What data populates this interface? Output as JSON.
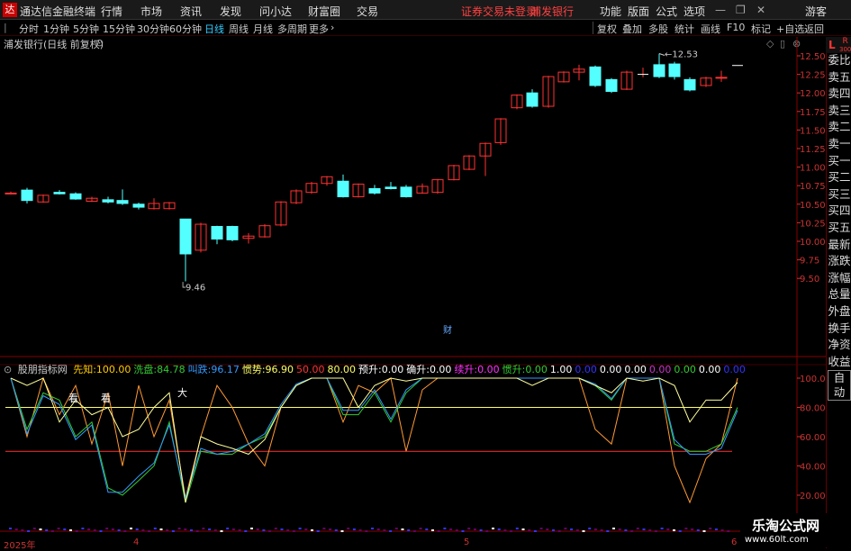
{
  "app": {
    "title": "通达信金融终端",
    "menu": [
      "行情",
      "市场",
      "资讯",
      "发现",
      "问小达",
      "财富圈",
      "交易"
    ],
    "warning": "证券交易未登录",
    "stock_name": "浦发银行",
    "right_menu": [
      "功能",
      "版面",
      "公式",
      "选项"
    ],
    "guest": "游客"
  },
  "toolbar": {
    "periods": [
      "分时",
      "1分钟",
      "5分钟",
      "15分钟",
      "30分钟",
      "60分钟",
      "日线",
      "周线",
      "月线",
      "多周期",
      "更多"
    ],
    "active_period": "日线",
    "more_arrow": "›",
    "right_buttons": [
      "复权",
      "叠加",
      "多股",
      "统计",
      "画线",
      "F10",
      "标记",
      "+自选",
      "返回"
    ]
  },
  "chart": {
    "subtitle": "浦发银行(日线 前复权)",
    "price_axis": [
      "12.50",
      "12.25",
      "12.00",
      "11.75",
      "11.50",
      "11.25",
      "11.00",
      "10.75",
      "10.50",
      "10.25",
      "10.00",
      "9.75",
      "9.50"
    ],
    "high_label": "12.53",
    "low_label": "9.46",
    "finance_marker": "财"
  },
  "indicator": {
    "name": "股朋指标网",
    "values": [
      {
        "label": "先知:",
        "value": "100.00",
        "color": "#ffcc00"
      },
      {
        "label": "洗盘:",
        "value": "84.78",
        "color": "#33cc33"
      },
      {
        "label": "叫跌:",
        "value": "96.17",
        "color": "#3399ff"
      },
      {
        "label": "惯势:",
        "value": "96.90",
        "color": "#ffff66"
      },
      {
        "label": "",
        "value": "50.00",
        "color": "#ff3333"
      },
      {
        "label": "",
        "value": "80.00",
        "color": "#ffff66"
      },
      {
        "label": "预升:",
        "value": "0.00",
        "color": "#ffffff"
      },
      {
        "label": "确升:",
        "value": "0.00",
        "color": "#ffffff"
      },
      {
        "label": "续升:",
        "value": "0.00",
        "color": "#ff33ff"
      },
      {
        "label": "惯升:",
        "value": "0.00",
        "color": "#33cc33"
      },
      {
        "label": "",
        "value": "1.00",
        "color": "#ffffff"
      },
      {
        "label": "",
        "value": "0.00",
        "color": "#3333ff"
      },
      {
        "label": "",
        "value": "0.00",
        "color": "#ffffff"
      },
      {
        "label": "",
        "value": "0.00",
        "color": "#ffffff"
      },
      {
        "label": "",
        "value": "0.00",
        "color": "#cc33cc"
      },
      {
        "label": "",
        "value": "0.00",
        "color": "#33cc33"
      },
      {
        "label": "",
        "value": "0.00",
        "color": "#ffffff"
      },
      {
        "label": "",
        "value": "0.00",
        "color": "#3333ff"
      }
    ],
    "axis": [
      "100.00",
      "80.00",
      "60.00",
      "40.00",
      "20.00"
    ],
    "annotations": [
      "看",
      "看",
      "大"
    ]
  },
  "dates": [
    "2025年",
    "4",
    "5",
    "6"
  ],
  "sidebar": {
    "top_L": "L",
    "top_R": "R",
    "top_R2": "300",
    "items": [
      "委比",
      "卖五",
      "卖四",
      "卖三",
      "卖二",
      "卖一",
      "买一",
      "买二",
      "买三",
      "买四",
      "买五",
      "最新",
      "涨跌",
      "涨幅",
      "总量",
      "外盘",
      "换手",
      "净资",
      "收益",
      "自动"
    ]
  },
  "watermark": {
    "line1": "乐淘公式网",
    "line2": "www.60lt.com"
  },
  "colors": {
    "up": "#ff3232",
    "down": "#54ffff",
    "accent": "#33ccff"
  }
}
